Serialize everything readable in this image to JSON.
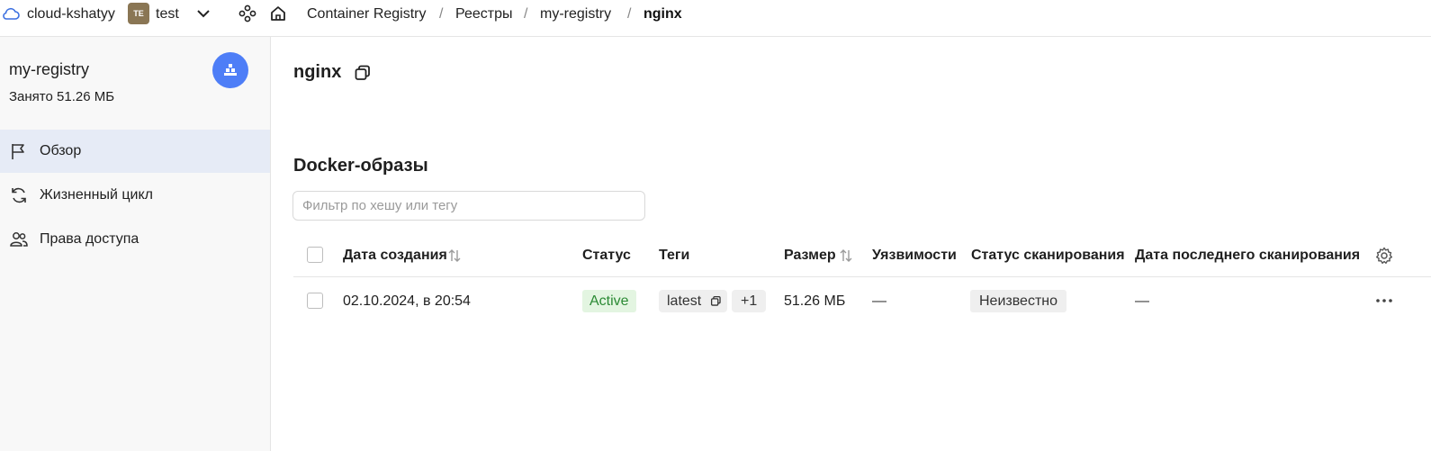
{
  "topbar": {
    "cloud_name": "cloud-kshatyy",
    "folder_avatar": "TE",
    "folder_name": "test",
    "breadcrumbs": [
      "Container Registry",
      "/",
      "Реестры",
      "/",
      "my-registry",
      "/",
      "nginx"
    ]
  },
  "sidebar": {
    "registry_name": "my-registry",
    "occupied": "Занято 51.26 МБ",
    "items": [
      {
        "label": "Обзор",
        "icon": "flag-icon",
        "active": true
      },
      {
        "label": "Жизненный цикл",
        "icon": "refresh-icon",
        "active": false
      },
      {
        "label": "Права доступа",
        "icon": "users-icon",
        "active": false
      }
    ]
  },
  "main": {
    "title": "nginx",
    "section_title": "Docker-образы",
    "filter_placeholder": "Фильтр по хешу или тегу",
    "columns": [
      "Дата создания",
      "Статус",
      "Теги",
      "Размер",
      "Уязвимости",
      "Статус сканирования",
      "Дата последнего сканирования"
    ],
    "rows": [
      {
        "created": "02.10.2024, в 20:54",
        "status": "Active",
        "tag": "latest",
        "tag_more": "+1",
        "size": "51.26 МБ",
        "vulnerabilities": "—",
        "scan_status": "Неизвестно",
        "last_scan": "—"
      }
    ]
  },
  "colors": {
    "accent": "#4e7ef7",
    "active_nav": "#e6ebf6",
    "status_active_bg": "#e3f5e1",
    "status_active_text": "#2b8a34"
  }
}
